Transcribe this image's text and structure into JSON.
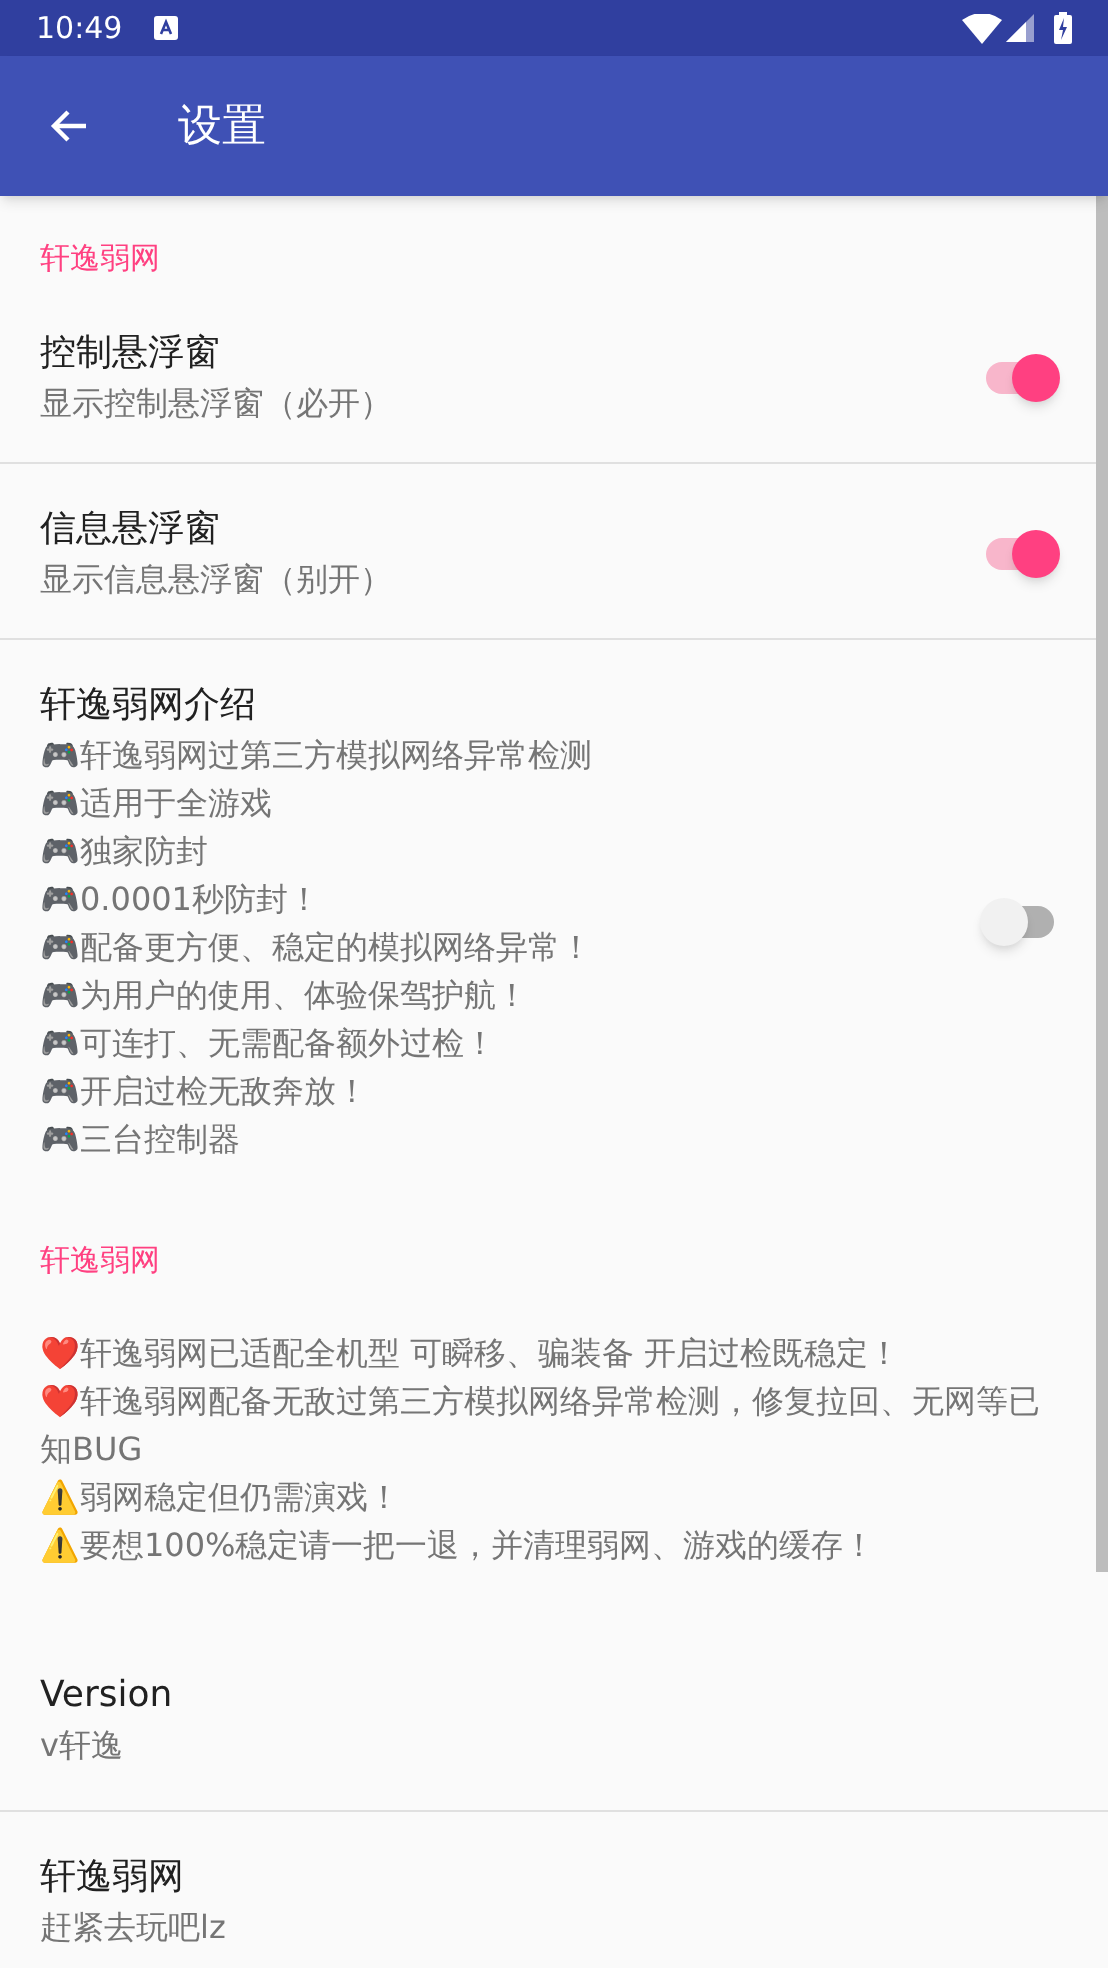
{
  "status_bar": {
    "time": "10:49"
  },
  "app_bar": {
    "title": "设置"
  },
  "sections": [
    {
      "kind": "category",
      "title": "轩逸弱网"
    },
    {
      "kind": "switch",
      "title": "控制悬浮窗",
      "summary": [
        "显示控制悬浮窗（必开）"
      ],
      "on": true
    },
    {
      "kind": "switch",
      "title": "信息悬浮窗",
      "summary": [
        "显示信息悬浮窗（别开）"
      ],
      "on": true
    },
    {
      "kind": "switch",
      "title": "轩逸弱网介绍",
      "summary": [
        "🎮轩逸弱网过第三方模拟网络异常检测",
        "🎮适用于全游戏",
        "🎮独家防封",
        "🎮0.0001秒防封！",
        "🎮配备更方便、稳定的模拟网络异常！",
        "🎮为用户的使用、体验保驾护航！",
        "🎮可连打、无需配备额外过检！",
        "🎮开启过检无敌奔放！",
        "🎮三台控制器"
      ],
      "on": false
    },
    {
      "kind": "category",
      "title": "轩逸弱网"
    },
    {
      "kind": "note",
      "summary": [
        "❤️轩逸弱网已适配全机型 可瞬移、骗装备 开启过检既稳定！",
        "❤️轩逸弱网配备无敌过第三方模拟网络异常检测，修复拉回、无网等已知BUG",
        "⚠️弱网稳定但仍需演戏！",
        "⚠️要想100%稳定请一把一退，并清理弱网、游戏的缓存！"
      ]
    },
    {
      "kind": "info",
      "title": "Version",
      "summary": [
        "v轩逸"
      ]
    },
    {
      "kind": "info",
      "title": "轩逸弱网",
      "summary": [
        "赶紧去玩吧lz"
      ]
    }
  ]
}
